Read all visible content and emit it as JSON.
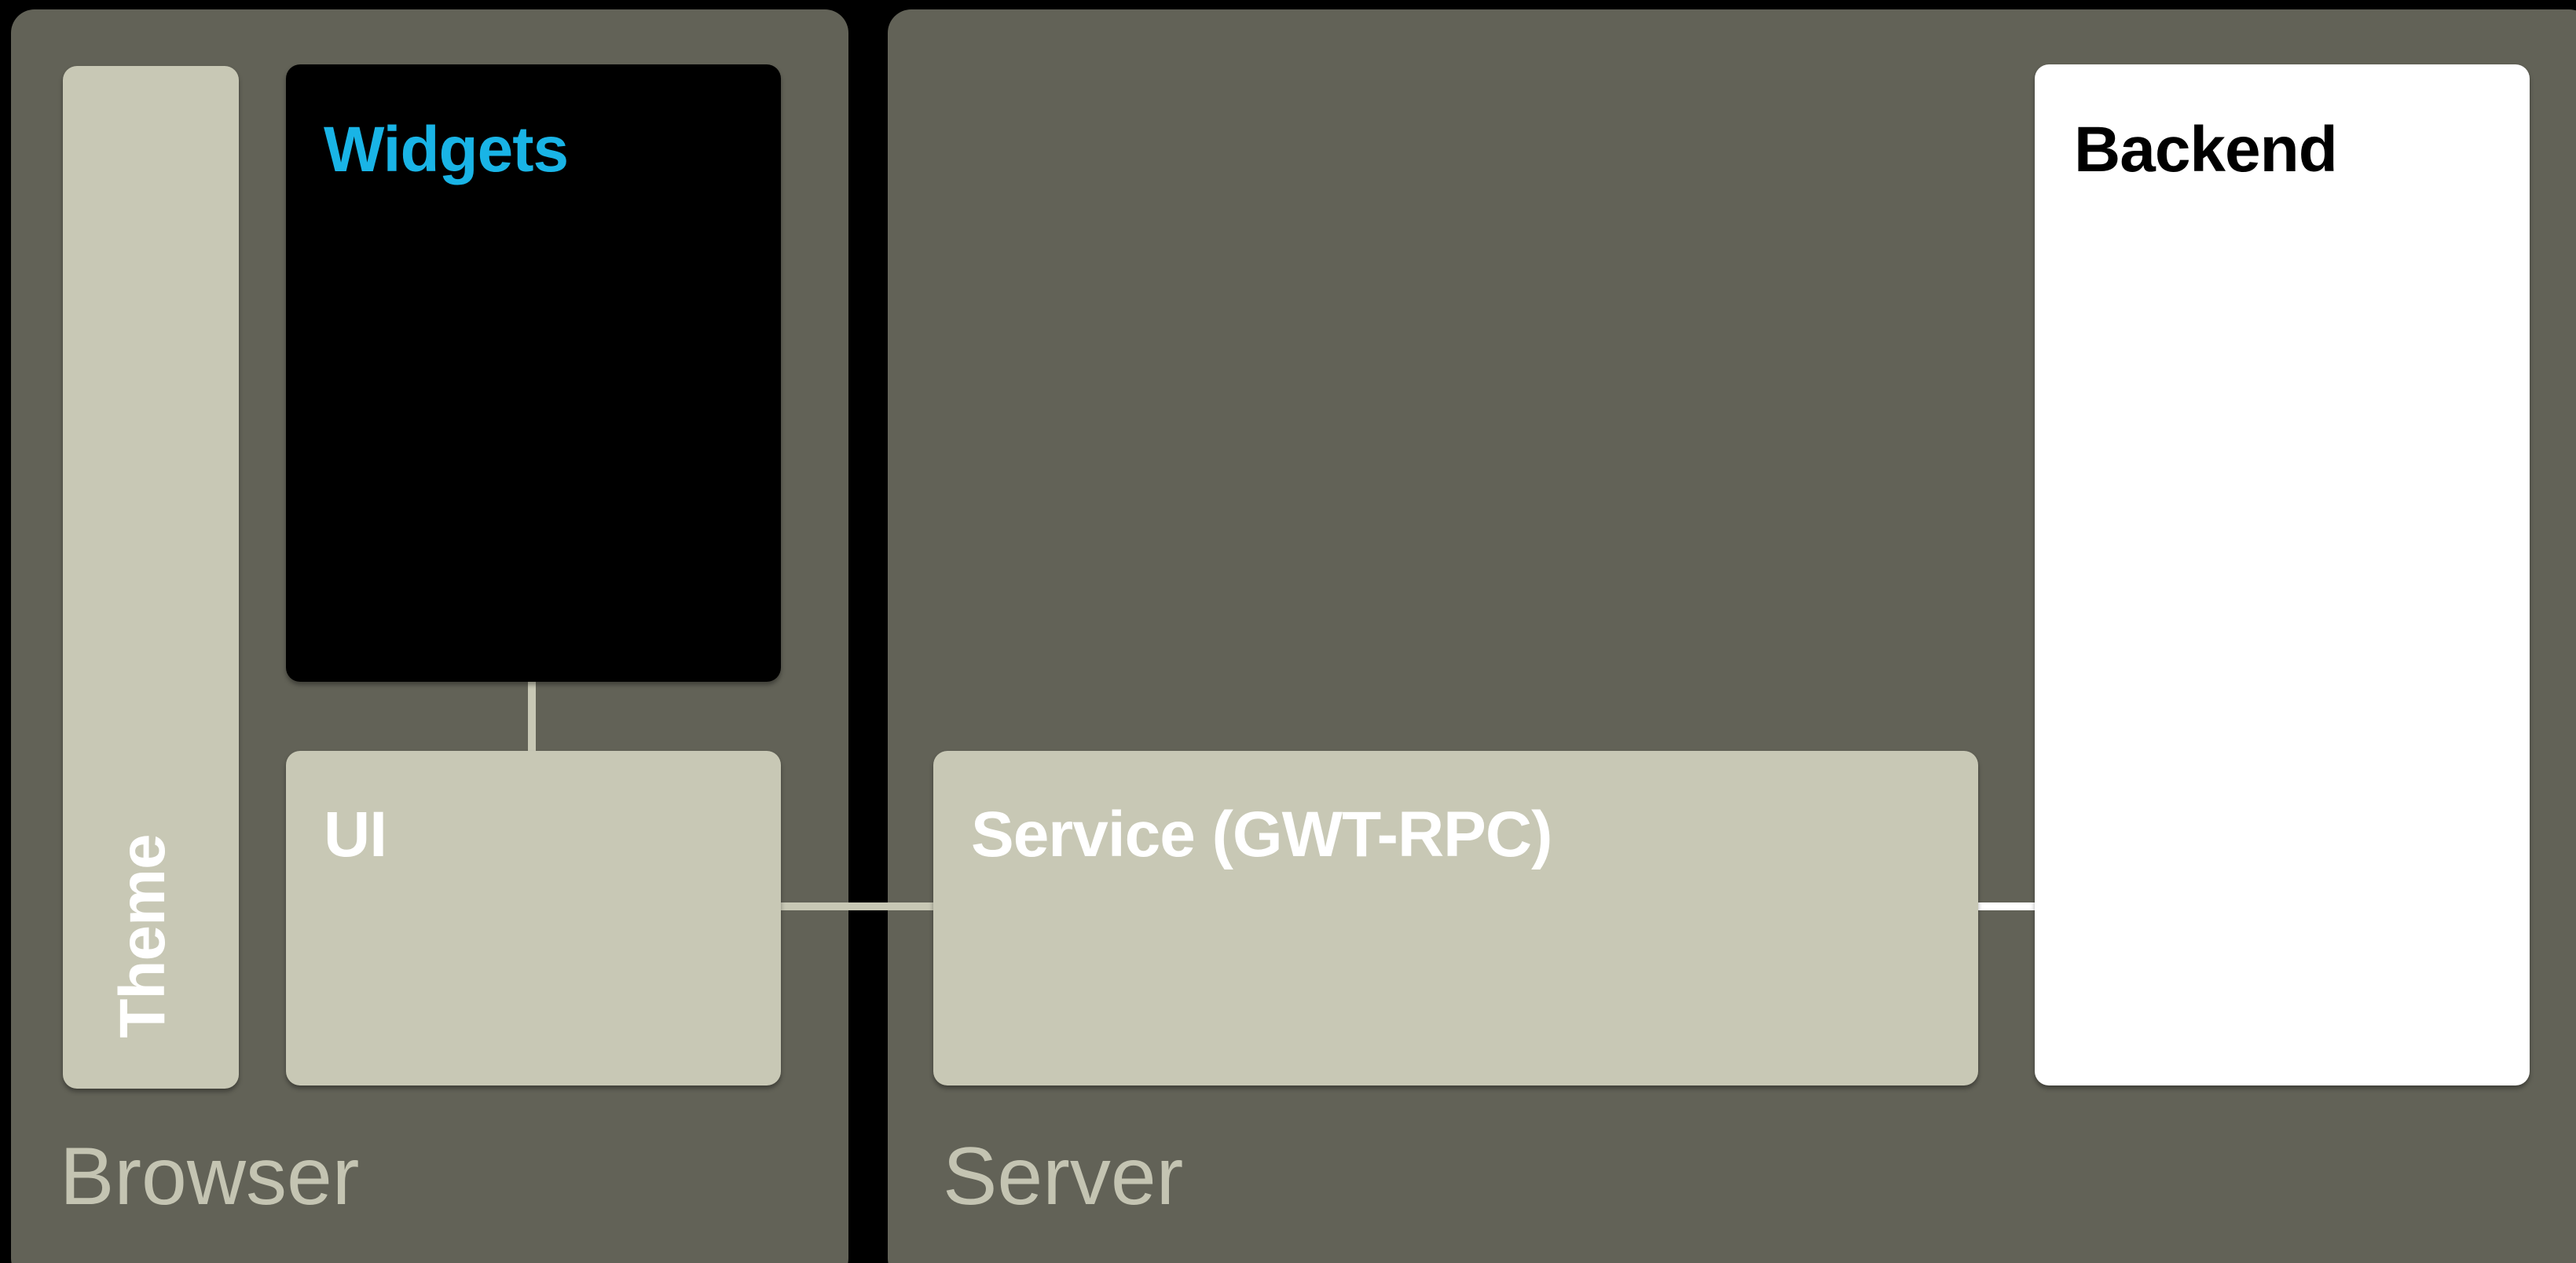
{
  "panels": {
    "browser": "Browser",
    "server": "Server"
  },
  "boxes": {
    "theme": "Theme",
    "widgets": "Widgets",
    "ui": "UI",
    "service": "Service (GWT-RPC)",
    "backend": "Backend"
  },
  "colors": {
    "background": "#000000",
    "panel": "#626257",
    "panel_label": "#c4c4b2",
    "light_box": "#c8c8b5",
    "widgets_box": "#000000",
    "widgets_text": "#19b4e6",
    "backend_box": "#ffffff",
    "backend_text": "#000000"
  }
}
